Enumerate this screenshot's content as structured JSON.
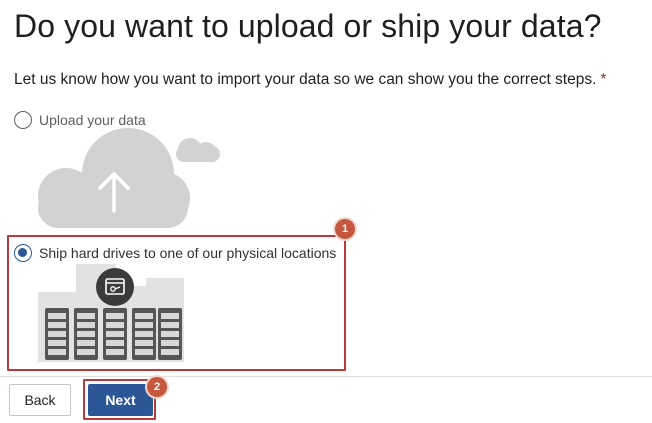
{
  "page": {
    "title": "Do you want to upload or ship your data?",
    "subtitle": "Let us know how you want to import your data so we can show you the correct steps.",
    "required_marker": "*"
  },
  "options": [
    {
      "label": "Upload your data",
      "selected": false,
      "illustration": "cloud-upload-icon"
    },
    {
      "label": "Ship hard drives to one of our physical locations",
      "selected": true,
      "illustration": "server-racks-icon"
    }
  ],
  "callouts": {
    "step1": "1",
    "step2": "2"
  },
  "footer": {
    "back_label": "Back",
    "next_label": "Next"
  },
  "colors": {
    "accent": "#2b5797",
    "highlight": "#b83b3b",
    "badge": "#c5573e",
    "illustration_gray": "#d2d2d2"
  }
}
